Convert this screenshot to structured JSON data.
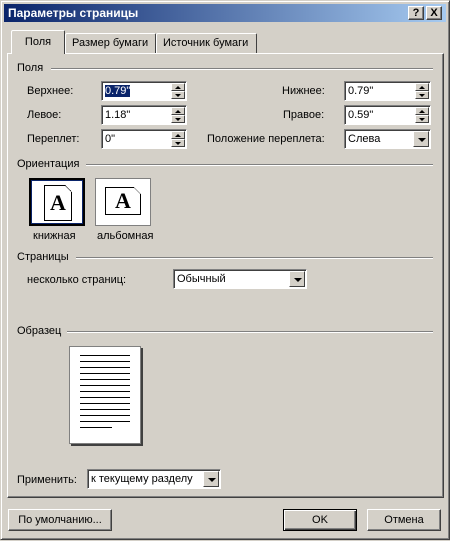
{
  "window": {
    "title": "Параметры страницы"
  },
  "titlebar_buttons": {
    "help": "?",
    "close": "X"
  },
  "tabs": [
    {
      "label": "Поля",
      "active": true
    },
    {
      "label": "Размер бумаги",
      "active": false
    },
    {
      "label": "Источник бумаги",
      "active": false
    }
  ],
  "margins": {
    "group_label": "Поля",
    "top_label": "Верхнее:",
    "top_value": "0.79\"",
    "bottom_label": "Нижнее:",
    "bottom_value": "0.79\"",
    "left_label": "Левое:",
    "left_value": "1.18\"",
    "right_label": "Правое:",
    "right_value": "0.59\"",
    "gutter_label": "Переплет:",
    "gutter_value": "0\"",
    "gutter_pos_label": "Положение переплета:",
    "gutter_pos_value": "Слева"
  },
  "orientation": {
    "group_label": "Ориентация",
    "glyph": "A",
    "portrait_label": "книжная",
    "landscape_label": "альбомная",
    "selected": "portrait"
  },
  "pages": {
    "group_label": "Страницы",
    "multiple_label": "несколько страниц:",
    "multiple_value": "Обычный"
  },
  "preview": {
    "group_label": "Образец",
    "apply_label": "Применить:",
    "apply_value": "к текущему разделу"
  },
  "buttons": {
    "default": "По умолчанию...",
    "ok": "OK",
    "cancel": "Отмена"
  }
}
